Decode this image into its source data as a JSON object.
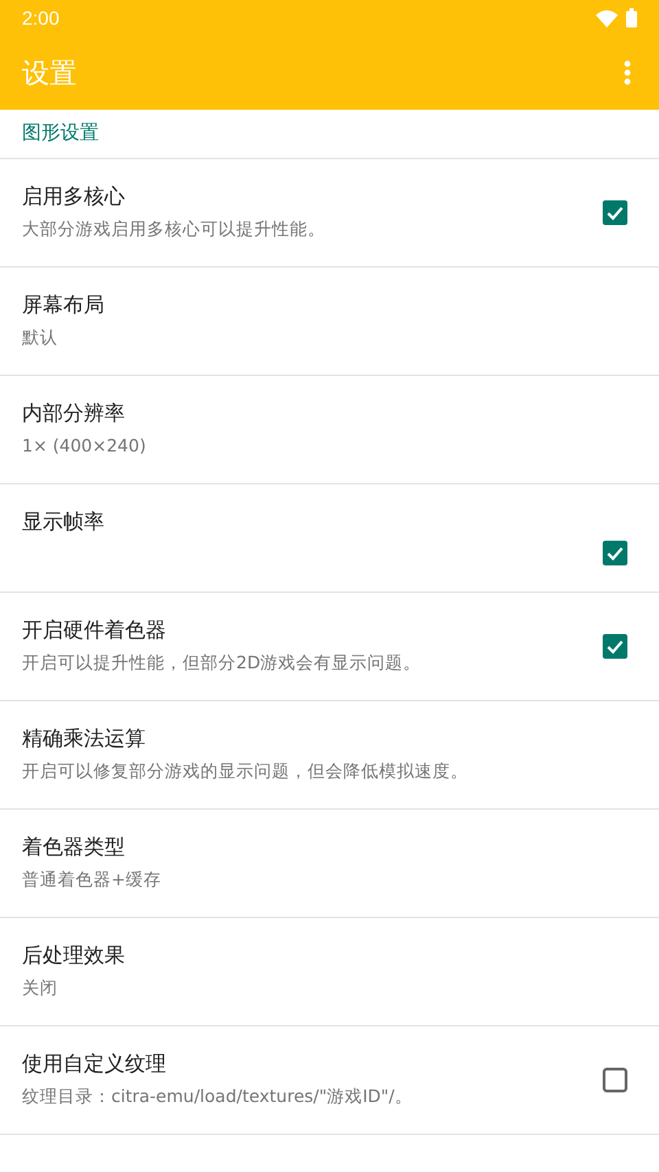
{
  "status_bar": {
    "time": "2:00"
  },
  "toolbar": {
    "title": "设置"
  },
  "section": {
    "title": "图形设置"
  },
  "items": [
    {
      "kind": "checkbox",
      "title": "启用多核心",
      "summary": "大部分游戏启用多核心可以提升性能。",
      "checked": true
    },
    {
      "kind": "text",
      "title": "屏幕布局",
      "summary": "默认"
    },
    {
      "kind": "text",
      "title": "内部分辨率",
      "summary": "1× (400×240)"
    },
    {
      "kind": "checkbox",
      "title": "显示帧率",
      "checked": true
    },
    {
      "kind": "checkbox",
      "title": "开启硬件着色器",
      "summary": "开启可以提升性能，但部分2D游戏会有显示问题。",
      "checked": true
    },
    {
      "kind": "text",
      "title": "精确乘法运算",
      "summary": "开启可以修复部分游戏的显示问题，但会降低模拟速度。"
    },
    {
      "kind": "text",
      "title": "着色器类型",
      "summary": "普通着色器+缓存"
    },
    {
      "kind": "text",
      "title": "后处理效果",
      "summary": "关闭"
    },
    {
      "kind": "checkbox",
      "title": "使用自定义纹理",
      "summary": "纹理目录：citra-emu/load/textures/\"游戏ID\"/。",
      "checked": false
    }
  ]
}
